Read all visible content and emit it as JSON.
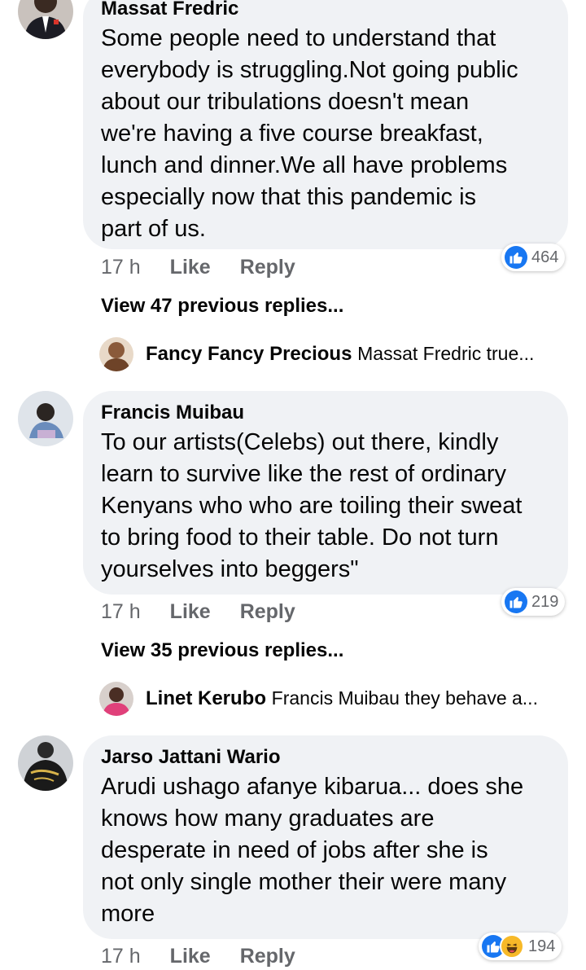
{
  "comments": [
    {
      "author": "Massat Fredric",
      "lines": [
        "Some people need to understand that",
        "everybody is struggling.Not going public",
        "about our tribulations doesn't mean",
        "we're having a five course breakfast,",
        "lunch and dinner.We all have problems",
        "especially now that this pandemic is",
        "part of us."
      ],
      "time": "17 h",
      "like_label": "Like",
      "reply_label": "Reply",
      "reaction_count": "464",
      "view_more": "View 47 previous replies...",
      "latest_reply": {
        "name": "Fancy Fancy Precious",
        "snippet": "Massat Fredric true..."
      }
    },
    {
      "author": "Francis Muibau",
      "lines": [
        "To our artists(Celebs) out there, kindly",
        "learn to survive like the rest of ordinary",
        "Kenyans who who are toiling their sweat",
        "to bring food to their table. Do not turn",
        "yourselves into beggers\""
      ],
      "time": "17 h",
      "like_label": "Like",
      "reply_label": "Reply",
      "reaction_count": "219",
      "view_more": "View 35 previous replies...",
      "latest_reply": {
        "name": "Linet Kerubo",
        "snippet": "Francis Muibau they behave a..."
      }
    },
    {
      "author": "Jarso Jattani Wario",
      "lines": [
        "Arudi ushago afanye kibarua... does she",
        "knows how many graduates are",
        "desperate in need of jobs after she is",
        "not only single mother their were many",
        "more"
      ],
      "time": "17 h",
      "like_label": "Like",
      "reply_label": "Reply",
      "reaction_count": "194"
    }
  ],
  "icons": {
    "like": "thumbs-up-icon",
    "haha": "laughing-face-icon"
  },
  "colors": {
    "bubble": "#f0f2f5",
    "like_blue": "#1877f2",
    "meta_gray": "#65676b",
    "haha_yellow": "#f7b928"
  }
}
